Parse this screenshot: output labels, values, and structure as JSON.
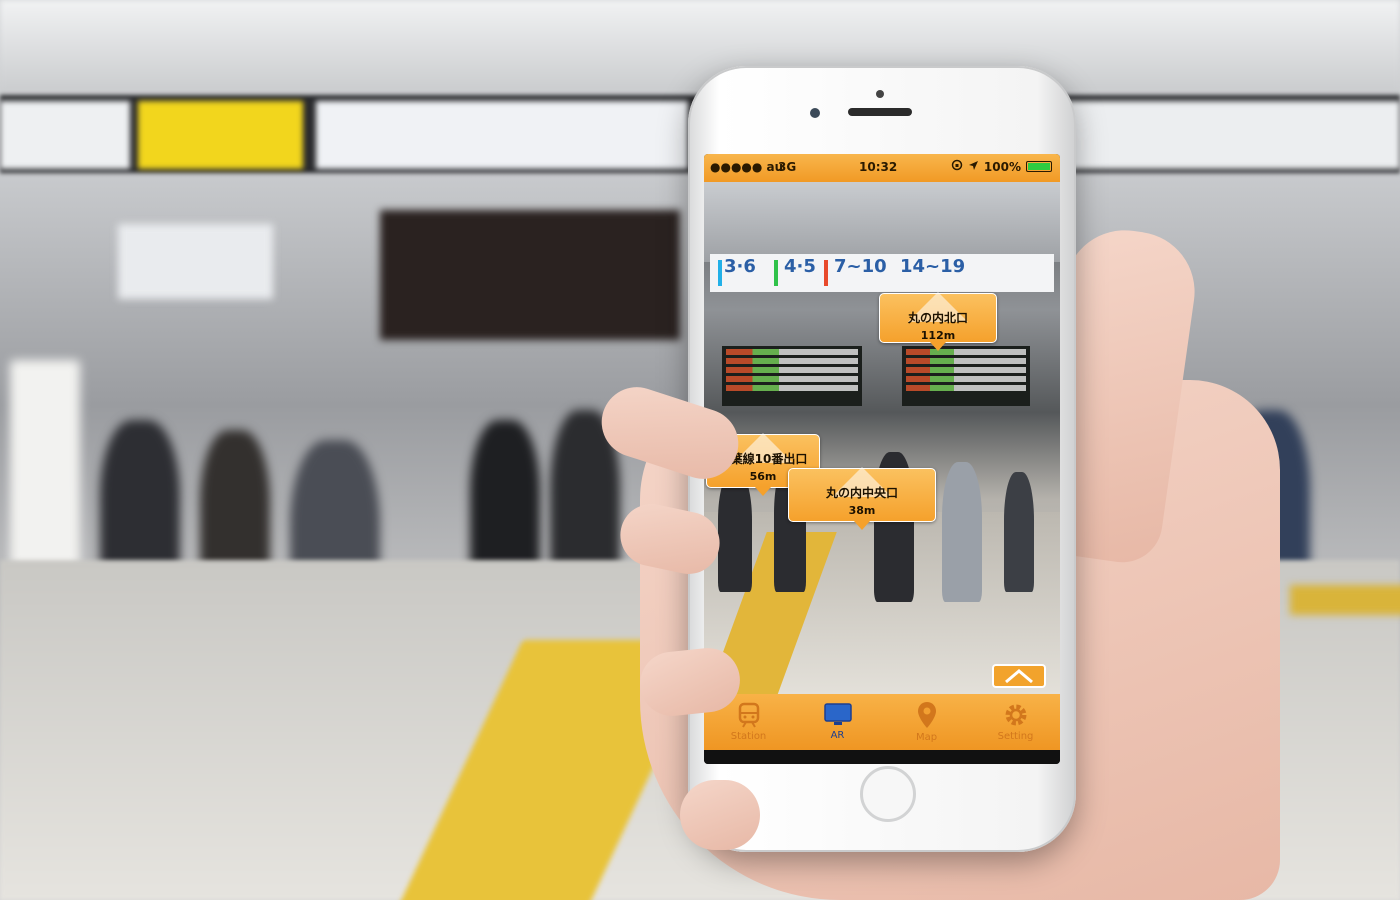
{
  "status_bar": {
    "carrier": "●●●●● au",
    "network": "3G",
    "time": "10:32",
    "battery": "100%",
    "battery_level": 1.0
  },
  "camera_signs": [
    "3·6",
    "4·5",
    "7~10",
    "14~19"
  ],
  "ar_markers": [
    {
      "name": "丸の内北口",
      "distance": "112m"
    },
    {
      "name": "京葉線10番出口",
      "distance": "56m"
    },
    {
      "name": "丸の内中央口",
      "distance": "38m"
    }
  ],
  "tabs": [
    {
      "label": "Station",
      "icon": "train-icon",
      "active": false
    },
    {
      "label": "AR",
      "icon": "monitor-icon",
      "active": true
    },
    {
      "label": "Map",
      "icon": "map-pin-icon",
      "active": false
    },
    {
      "label": "Setting",
      "icon": "gear-icon",
      "active": false
    }
  ],
  "colors": {
    "accent": "#f5a12c",
    "active_tab": "#1d3f8f"
  }
}
